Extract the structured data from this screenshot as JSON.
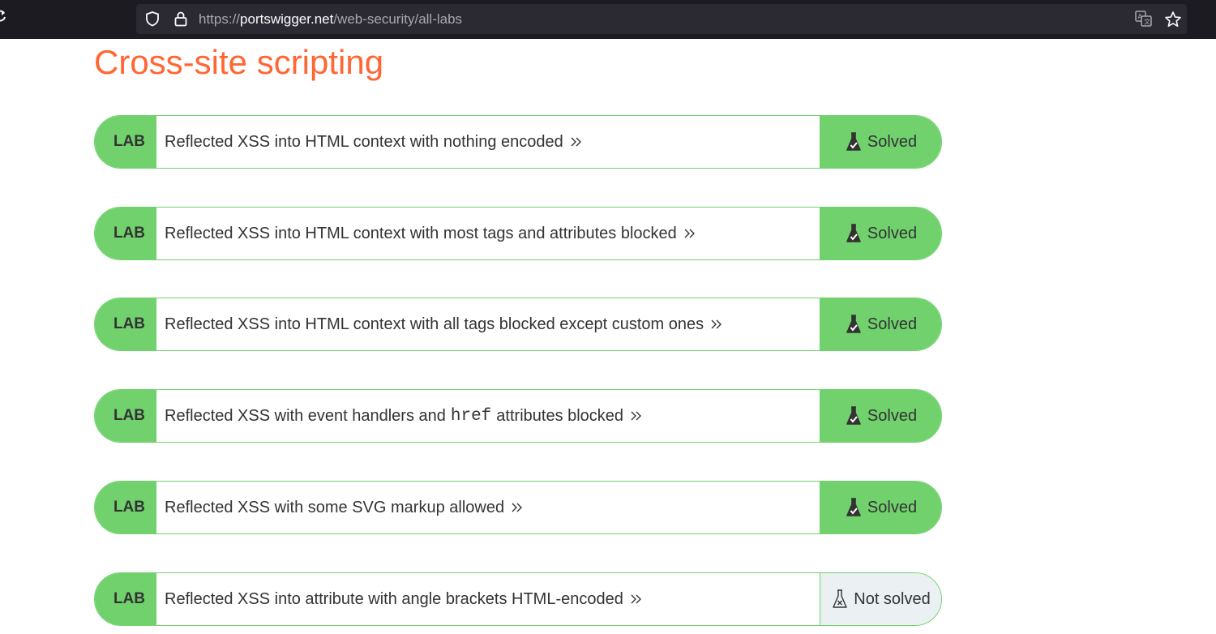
{
  "browser": {
    "url_prefix": "https://",
    "url_domain": "portswigger.net",
    "url_path": "/web-security/all-labs"
  },
  "page": {
    "section_title": "Cross-site scripting"
  },
  "labs": [
    {
      "tag": "LAB",
      "title_before": "Reflected XSS into HTML context with nothing encoded",
      "code": "",
      "title_after": "",
      "status": "Solved",
      "solved": true
    },
    {
      "tag": "LAB",
      "title_before": "Reflected XSS into HTML context with most tags and attributes blocked",
      "code": "",
      "title_after": "",
      "status": "Solved",
      "solved": true
    },
    {
      "tag": "LAB",
      "title_before": "Reflected XSS into HTML context with all tags blocked except custom ones",
      "code": "",
      "title_after": "",
      "status": "Solved",
      "solved": true
    },
    {
      "tag": "LAB",
      "title_before": "Reflected XSS with event handlers and",
      "code": "href",
      "title_after": "attributes blocked",
      "status": "Solved",
      "solved": true
    },
    {
      "tag": "LAB",
      "title_before": "Reflected XSS with some SVG markup allowed",
      "code": "",
      "title_after": "",
      "status": "Solved",
      "solved": true
    },
    {
      "tag": "LAB",
      "title_before": "Reflected XSS into attribute with angle brackets HTML-encoded",
      "code": "",
      "title_after": "",
      "status": "Not solved",
      "solved": false
    }
  ],
  "colors": {
    "accent": "#ff6633",
    "lab_green": "#70d16d",
    "not_solved_bg": "#ebf0f2"
  },
  "icons": {
    "solved": "flask-check-icon",
    "not_solved": "flask-x-icon",
    "chevron": "double-chevron-right-icon"
  }
}
